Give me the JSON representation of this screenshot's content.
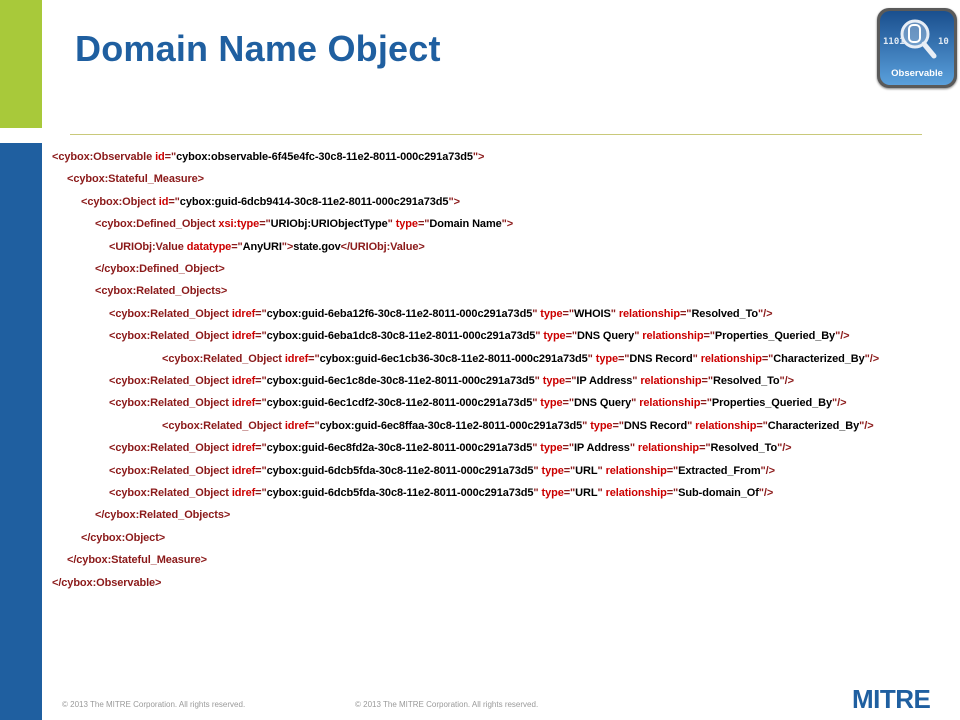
{
  "title": "Domain Name Object",
  "logo": {
    "label": "Observable",
    "bits_left": "1101",
    "bits_right": "10"
  },
  "footer": {
    "left": "© 2013 The MITRE Corporation. All rights reserved.",
    "right": "© 2013 The MITRE Corporation. All rights reserved."
  },
  "brand": "MITRE",
  "code_lines": [
    [
      [
        "t",
        "<cybox:Observable "
      ],
      [
        "a",
        "id"
      ],
      [
        "t",
        "=\""
      ],
      [
        "v",
        "cybox:observable-6f45e4fc-30c8-11e2-8011-000c291a73d5"
      ],
      [
        "t",
        "\">"
      ]
    ],
    [
      [
        "t",
        "<cybox:Stateful_Measure>"
      ]
    ],
    [
      [
        "t",
        "<cybox:Object "
      ],
      [
        "a",
        "id"
      ],
      [
        "t",
        "=\""
      ],
      [
        "v",
        "cybox:guid-6dcb9414-30c8-11e2-8011-000c291a73d5"
      ],
      [
        "t",
        "\">"
      ]
    ],
    [
      [
        "t",
        "<cybox:Defined_Object "
      ],
      [
        "a",
        "xsi:type"
      ],
      [
        "t",
        "=\""
      ],
      [
        "v",
        "URIObj:URIObjectType"
      ],
      [
        "t",
        "\"  "
      ],
      [
        "a",
        "type"
      ],
      [
        "t",
        "=\""
      ],
      [
        "v",
        "Domain Name"
      ],
      [
        "t",
        "\">"
      ]
    ],
    [
      [
        "t",
        "<URIObj:Value "
      ],
      [
        "a",
        "datatype"
      ],
      [
        "t",
        "=\""
      ],
      [
        "v",
        "AnyURI"
      ],
      [
        "t",
        "\">"
      ],
      [
        "x",
        "state.gov"
      ],
      [
        "t",
        "</URIObj:Value>"
      ]
    ],
    [
      [
        "t",
        "</cybox:Defined_Object>"
      ]
    ],
    [
      [
        "t",
        "<cybox:Related_Objects>"
      ]
    ],
    [
      [
        "t",
        "<cybox:Related_Object "
      ],
      [
        "a",
        "idref"
      ],
      [
        "t",
        "=\""
      ],
      [
        "v",
        "cybox:guid-6eba12f6-30c8-11e2-8011-000c291a73d5"
      ],
      [
        "t",
        "\" "
      ],
      [
        "a",
        "type"
      ],
      [
        "t",
        "=\""
      ],
      [
        "v",
        "WHOIS"
      ],
      [
        "t",
        "\" "
      ],
      [
        "a",
        "relationship"
      ],
      [
        "t",
        "=\""
      ],
      [
        "v",
        "Resolved_To"
      ],
      [
        "t",
        "\"/>"
      ]
    ],
    [
      [
        "t",
        "<cybox:Related_Object "
      ],
      [
        "a",
        "idref"
      ],
      [
        "t",
        "=\""
      ],
      [
        "v",
        "cybox:guid-6eba1dc8-30c8-11e2-8011-000c291a73d5"
      ],
      [
        "t",
        "\" "
      ],
      [
        "a",
        "type"
      ],
      [
        "t",
        "=\""
      ],
      [
        "v",
        "DNS Query"
      ],
      [
        "t",
        "\" "
      ],
      [
        "a",
        "relationship"
      ],
      [
        "t",
        "=\""
      ],
      [
        "v",
        "Properties_Queried_By"
      ],
      [
        "t",
        "\"/>"
      ]
    ],
    [
      [
        "t",
        "<cybox:Related_Object "
      ],
      [
        "a",
        "idref"
      ],
      [
        "t",
        "=\""
      ],
      [
        "v",
        "cybox:guid-6ec1cb36-30c8-11e2-8011-000c291a73d5"
      ],
      [
        "t",
        "\" "
      ],
      [
        "a",
        "type"
      ],
      [
        "t",
        "=\""
      ],
      [
        "v",
        "DNS Record"
      ],
      [
        "t",
        "\" "
      ],
      [
        "a",
        "relationship"
      ],
      [
        "t",
        "=\""
      ],
      [
        "v",
        "Characterized_By"
      ],
      [
        "t",
        "\"/>"
      ]
    ],
    [
      [
        "t",
        "<cybox:Related_Object "
      ],
      [
        "a",
        "idref"
      ],
      [
        "t",
        "=\""
      ],
      [
        "v",
        "cybox:guid-6ec1c8de-30c8-11e2-8011-000c291a73d5"
      ],
      [
        "t",
        "\" "
      ],
      [
        "a",
        "type"
      ],
      [
        "t",
        "=\""
      ],
      [
        "v",
        "IP Address"
      ],
      [
        "t",
        "\" "
      ],
      [
        "a",
        "relationship"
      ],
      [
        "t",
        "=\""
      ],
      [
        "v",
        "Resolved_To"
      ],
      [
        "t",
        "\"/>"
      ]
    ],
    [
      [
        "t",
        "<cybox:Related_Object "
      ],
      [
        "a",
        "idref"
      ],
      [
        "t",
        "=\""
      ],
      [
        "v",
        "cybox:guid-6ec1cdf2-30c8-11e2-8011-000c291a73d5"
      ],
      [
        "t",
        "\" "
      ],
      [
        "a",
        "type"
      ],
      [
        "t",
        "=\""
      ],
      [
        "v",
        "DNS Query"
      ],
      [
        "t",
        "\" "
      ],
      [
        "a",
        "relationship"
      ],
      [
        "t",
        "=\""
      ],
      [
        "v",
        "Properties_Queried_By"
      ],
      [
        "t",
        "\"/>"
      ]
    ],
    [
      [
        "t",
        "<cybox:Related_Object "
      ],
      [
        "a",
        "idref"
      ],
      [
        "t",
        "=\""
      ],
      [
        "v",
        "cybox:guid-6ec8ffaa-30c8-11e2-8011-000c291a73d5"
      ],
      [
        "t",
        "\" "
      ],
      [
        "a",
        "type"
      ],
      [
        "t",
        "=\""
      ],
      [
        "v",
        "DNS Record"
      ],
      [
        "t",
        "\" "
      ],
      [
        "a",
        "relationship"
      ],
      [
        "t",
        "=\""
      ],
      [
        "v",
        "Characterized_By"
      ],
      [
        "t",
        "\"/>"
      ]
    ],
    [
      [
        "t",
        "<cybox:Related_Object "
      ],
      [
        "a",
        "idref"
      ],
      [
        "t",
        "=\""
      ],
      [
        "v",
        "cybox:guid-6ec8fd2a-30c8-11e2-8011-000c291a73d5"
      ],
      [
        "t",
        "\" "
      ],
      [
        "a",
        "type"
      ],
      [
        "t",
        "=\""
      ],
      [
        "v",
        "IP Address"
      ],
      [
        "t",
        "\" "
      ],
      [
        "a",
        "relationship"
      ],
      [
        "t",
        "=\""
      ],
      [
        "v",
        "Resolved_To"
      ],
      [
        "t",
        "\"/>"
      ]
    ],
    [
      [
        "t",
        "<cybox:Related_Object "
      ],
      [
        "a",
        "idref"
      ],
      [
        "t",
        "=\""
      ],
      [
        "v",
        "cybox:guid-6dcb5fda-30c8-11e2-8011-000c291a73d5"
      ],
      [
        "t",
        "\" "
      ],
      [
        "a",
        "type"
      ],
      [
        "t",
        "=\""
      ],
      [
        "v",
        "URL"
      ],
      [
        "t",
        "\" "
      ],
      [
        "a",
        "relationship"
      ],
      [
        "t",
        "=\""
      ],
      [
        "v",
        "Extracted_From"
      ],
      [
        "t",
        "\"/>"
      ]
    ],
    [
      [
        "t",
        "<cybox:Related_Object "
      ],
      [
        "a",
        "idref"
      ],
      [
        "t",
        "=\""
      ],
      [
        "v",
        "cybox:guid-6dcb5fda-30c8-11e2-8011-000c291a73d5"
      ],
      [
        "t",
        "\" "
      ],
      [
        "a",
        "type"
      ],
      [
        "t",
        "=\""
      ],
      [
        "v",
        "URL"
      ],
      [
        "t",
        "\" "
      ],
      [
        "a",
        "relationship"
      ],
      [
        "t",
        "=\""
      ],
      [
        "v",
        "Sub-domain_Of"
      ],
      [
        "t",
        "\"/>"
      ]
    ],
    [
      [
        "t",
        "</cybox:Related_Objects>"
      ]
    ],
    [
      [
        "t",
        "</cybox:Object>"
      ]
    ],
    [
      [
        "t",
        "</cybox:Stateful_Measure>"
      ]
    ],
    [
      [
        "t",
        "</cybox:Observable>"
      ]
    ]
  ]
}
